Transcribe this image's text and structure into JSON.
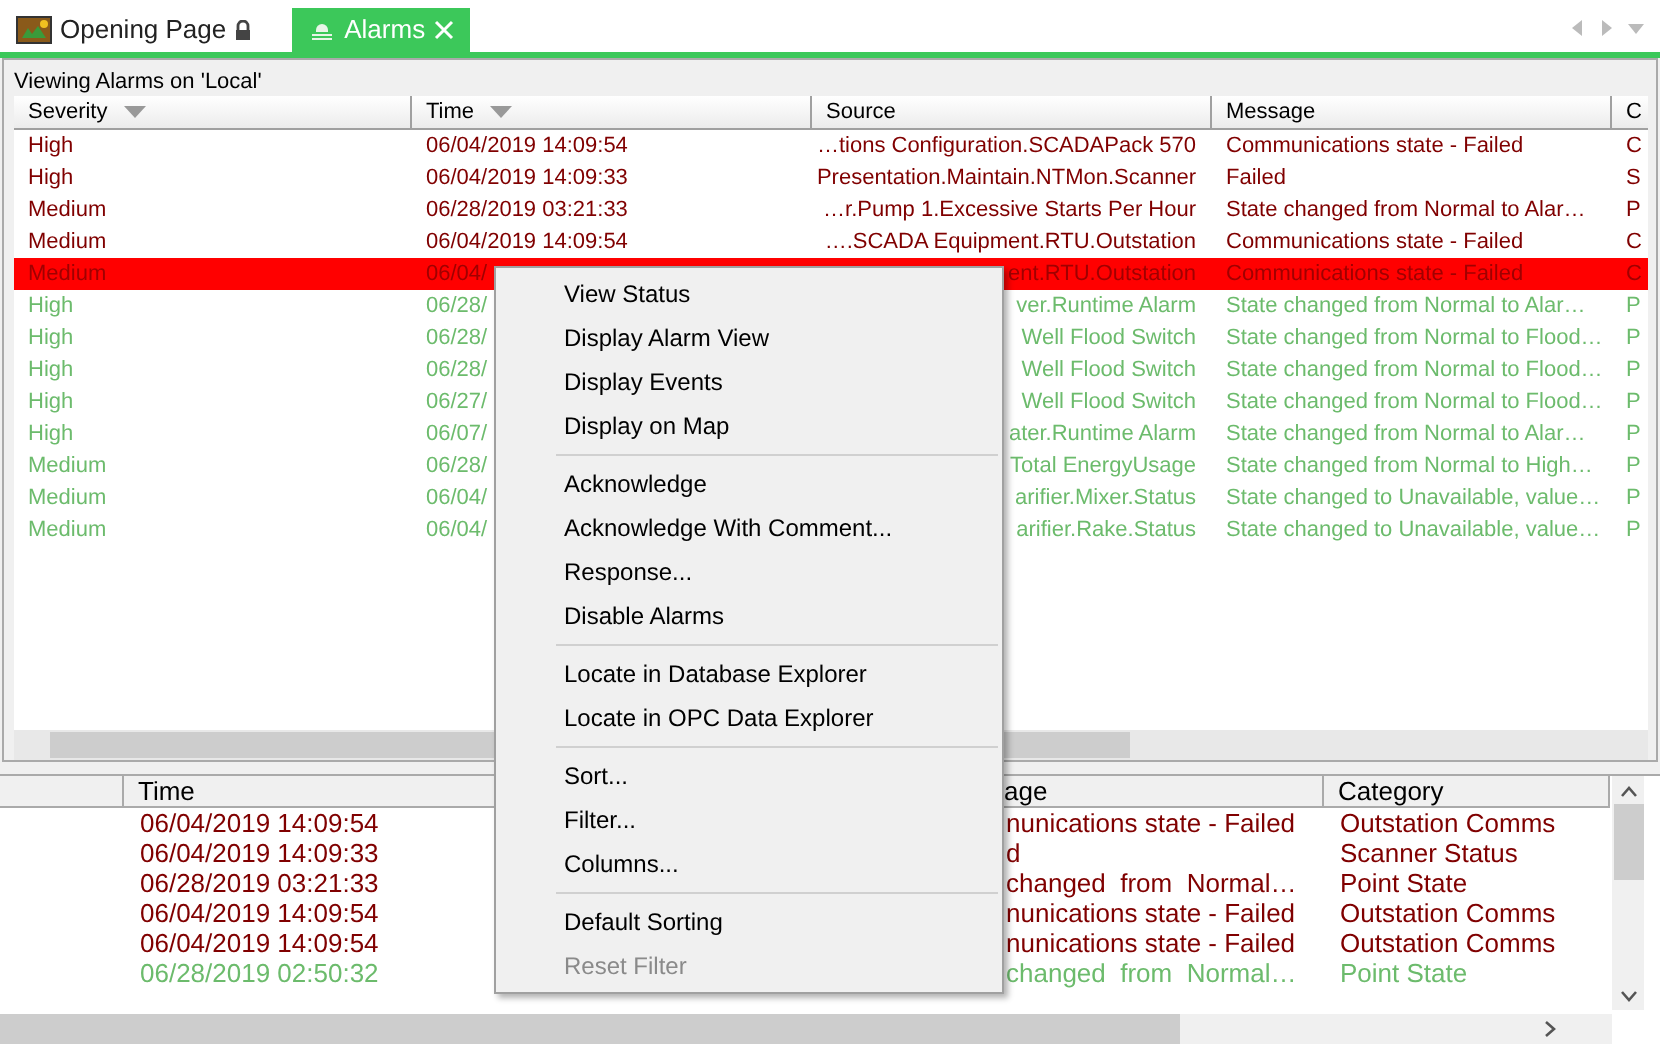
{
  "tabs": [
    {
      "label": "Opening Page",
      "selected": false,
      "locked": true
    },
    {
      "label": "Alarms",
      "selected": true,
      "locked": false
    }
  ],
  "alarm_view": {
    "title": "Viewing Alarms on 'Local'",
    "columns": [
      {
        "label": "Severity",
        "sortable": true
      },
      {
        "label": "Time",
        "sortable": true
      },
      {
        "label": "Source",
        "sortable": false
      },
      {
        "label": "Message",
        "sortable": false
      },
      {
        "label": "C"
      }
    ],
    "rows": [
      {
        "selected": false,
        "acknowledged": false,
        "cells": [
          "High",
          "06/04/2019 14:09:54",
          "…tions Configuration.SCADAPack 570",
          "Communications state - Failed",
          "C"
        ]
      },
      {
        "selected": false,
        "acknowledged": false,
        "cells": [
          "High",
          "06/04/2019 14:09:33",
          "Presentation.Maintain.NTMon.Scanner",
          "Failed",
          "S"
        ]
      },
      {
        "selected": false,
        "acknowledged": false,
        "cells": [
          "Medium",
          "06/28/2019 03:21:33",
          "…r.Pump 1.Excessive Starts Per Hour",
          "State changed from Normal to Alar…",
          "P"
        ]
      },
      {
        "selected": false,
        "acknowledged": false,
        "cells": [
          "Medium",
          "06/04/2019 14:09:54",
          "….SCADA Equipment.RTU.Outstation",
          "Communications state - Failed",
          "C"
        ]
      },
      {
        "selected": true,
        "acknowledged": false,
        "cells": [
          "Medium",
          "06/04/",
          "ent.RTU.Outstation",
          "Communications state - Failed",
          "C"
        ]
      },
      {
        "selected": false,
        "acknowledged": true,
        "cells": [
          "High",
          "06/28/",
          "ver.Runtime Alarm",
          "State changed from Normal to Alar…",
          "P"
        ]
      },
      {
        "selected": false,
        "acknowledged": true,
        "cells": [
          "High",
          "06/28/",
          "Well Flood Switch",
          "State changed from Normal to Flood…",
          "P"
        ]
      },
      {
        "selected": false,
        "acknowledged": true,
        "cells": [
          "High",
          "06/28/",
          "Well Flood Switch",
          "State changed from Normal to Flood…",
          "P"
        ]
      },
      {
        "selected": false,
        "acknowledged": true,
        "cells": [
          "High",
          "06/27/",
          "Well Flood Switch",
          "State changed from Normal to Flood…",
          "P"
        ]
      },
      {
        "selected": false,
        "acknowledged": true,
        "cells": [
          "High",
          "06/07/",
          "ater.Runtime Alarm",
          "State changed from Normal to Alar…",
          "P"
        ]
      },
      {
        "selected": false,
        "acknowledged": true,
        "cells": [
          "Medium",
          "06/28/",
          "Total EnergyUsage",
          "State changed from Normal to High…",
          "P"
        ]
      },
      {
        "selected": false,
        "acknowledged": true,
        "cells": [
          "Medium",
          "06/04/",
          "arifier.Mixer.Status",
          "State changed to Unavailable, value…",
          "P"
        ]
      },
      {
        "selected": false,
        "acknowledged": true,
        "cells": [
          "Medium",
          "06/04/",
          "arifier.Rake.Status",
          "State changed to Unavailable, value…",
          "P"
        ]
      }
    ]
  },
  "banner_list": {
    "columns": [
      "Time",
      "age",
      "Category"
    ],
    "rows": [
      {
        "acknowledged": false,
        "cells": [
          "06/04/2019 14:09:54",
          "nunications state - Failed",
          "Outstation Comms"
        ]
      },
      {
        "acknowledged": false,
        "cells": [
          "06/04/2019 14:09:33",
          "d",
          "Scanner Status"
        ]
      },
      {
        "acknowledged": false,
        "cells": [
          "06/28/2019 03:21:33",
          "changed  from  Normal…",
          "Point State"
        ]
      },
      {
        "acknowledged": false,
        "cells": [
          "06/04/2019 14:09:54",
          "nunications state - Failed",
          "Outstation Comms"
        ]
      },
      {
        "acknowledged": false,
        "cells": [
          "06/04/2019 14:09:54",
          "nunications state - Failed",
          "Outstation Comms"
        ]
      },
      {
        "acknowledged": true,
        "cells": [
          "06/28/2019 02:50:32",
          "changed  from  Normal…",
          "Point State"
        ]
      }
    ]
  },
  "context_menu": {
    "groups": [
      [
        {
          "label": "View Status",
          "disabled": false
        },
        {
          "label": "Display Alarm View",
          "disabled": false
        },
        {
          "label": "Display Events",
          "disabled": false
        },
        {
          "label": "Display on Map",
          "disabled": false
        }
      ],
      [
        {
          "label": "Acknowledge",
          "disabled": false
        },
        {
          "label": "Acknowledge With Comment...",
          "disabled": false
        },
        {
          "label": "Response...",
          "disabled": false
        },
        {
          "label": "Disable Alarms",
          "disabled": false
        }
      ],
      [
        {
          "label": "Locate in Database Explorer",
          "disabled": false
        },
        {
          "label": "Locate in OPC Data Explorer",
          "disabled": false
        }
      ],
      [
        {
          "label": "Sort...",
          "disabled": false
        },
        {
          "label": "Filter...",
          "disabled": false
        },
        {
          "label": "Columns...",
          "disabled": false
        }
      ],
      [
        {
          "label": "Default Sorting",
          "disabled": false
        },
        {
          "label": "Reset Filter",
          "disabled": true
        }
      ]
    ]
  }
}
